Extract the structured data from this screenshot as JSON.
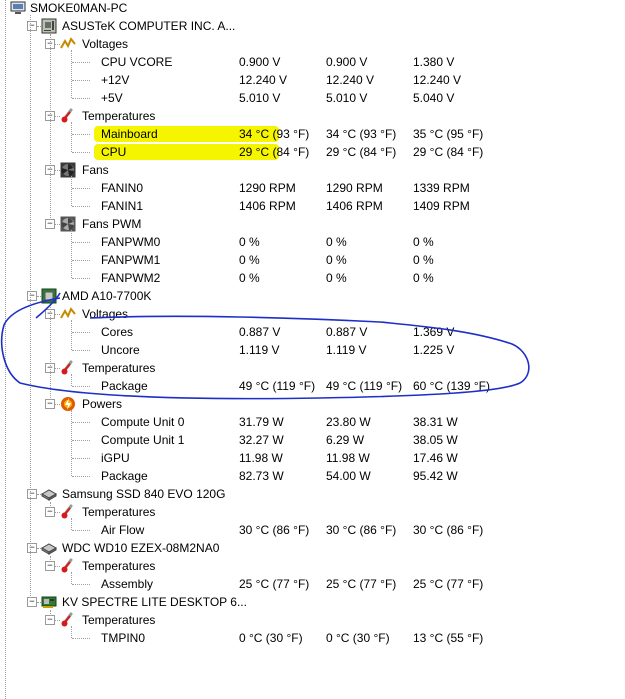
{
  "root": {
    "label": "SMOKE0MAN-PC"
  },
  "nodes": [
    {
      "id": "asus",
      "label": "ASUSTeK COMPUTER INC. A...",
      "icon": "motherboard-icon",
      "groups": [
        {
          "label": "Voltages",
          "icon": "voltage-icon",
          "rows": [
            {
              "name": "CPU VCORE",
              "v": [
                "0.900 V",
                "0.900 V",
                "1.380 V"
              ]
            },
            {
              "name": "+12V",
              "v": [
                "12.240 V",
                "12.240 V",
                "12.240 V"
              ]
            },
            {
              "name": "+5V",
              "v": [
                "5.010 V",
                "5.010 V",
                "5.040 V"
              ]
            }
          ]
        },
        {
          "label": "Temperatures",
          "icon": "thermometer-icon",
          "rows": [
            {
              "name": "Mainboard",
              "v": [
                "34 °C  (93 °F)",
                "34 °C  (93 °F)",
                "35 °C  (95 °F)"
              ],
              "highlight": true
            },
            {
              "name": "CPU",
              "v": [
                "29 °C  (84 °F)",
                "29 °C  (84 °F)",
                "29 °C  (84 °F)"
              ],
              "highlight": true
            }
          ]
        },
        {
          "label": "Fans",
          "icon": "fan-icon",
          "rows": [
            {
              "name": "FANIN0",
              "v": [
                "1290 RPM",
                "1290 RPM",
                "1339 RPM"
              ]
            },
            {
              "name": "FANIN1",
              "v": [
                "1406 RPM",
                "1406 RPM",
                "1409 RPM"
              ]
            }
          ]
        },
        {
          "label": "Fans PWM",
          "icon": "fan-pwm-icon",
          "rows": [
            {
              "name": "FANPWM0",
              "v": [
                "0 %",
                "0 %",
                "0 %"
              ]
            },
            {
              "name": "FANPWM1",
              "v": [
                "0 %",
                "0 %",
                "0 %"
              ]
            },
            {
              "name": "FANPWM2",
              "v": [
                "0 %",
                "0 %",
                "0 %"
              ]
            }
          ]
        }
      ]
    },
    {
      "id": "amd",
      "label": "AMD A10-7700K",
      "icon": "cpu-chip-icon",
      "groups": [
        {
          "label": "Voltages",
          "icon": "voltage-icon",
          "rows": [
            {
              "name": "Cores",
              "v": [
                "0.887 V",
                "0.887 V",
                "1.369 V"
              ]
            },
            {
              "name": "Uncore",
              "v": [
                "1.119 V",
                "1.119 V",
                "1.225 V"
              ]
            }
          ]
        },
        {
          "label": "Temperatures",
          "icon": "thermometer-icon",
          "rows": [
            {
              "name": "Package",
              "v": [
                "49 °C  (119 °F)",
                "49 °C  (119 °F)",
                "60 °C  (139 °F)"
              ]
            }
          ]
        },
        {
          "label": "Powers",
          "icon": "power-icon",
          "rows": [
            {
              "name": "Compute Unit 0",
              "v": [
                "31.79 W",
                "23.80 W",
                "38.31 W"
              ]
            },
            {
              "name": "Compute Unit 1",
              "v": [
                "32.27 W",
                "6.29 W",
                "38.05 W"
              ]
            },
            {
              "name": "iGPU",
              "v": [
                "11.98 W",
                "11.98 W",
                "17.46 W"
              ]
            },
            {
              "name": "Package",
              "v": [
                "82.73 W",
                "54.00 W",
                "95.42 W"
              ]
            }
          ]
        }
      ]
    },
    {
      "id": "ssd",
      "label": "Samsung SSD 840 EVO 120G",
      "icon": "disk-drive-icon",
      "groups": [
        {
          "label": "Temperatures",
          "icon": "thermometer-icon",
          "rows": [
            {
              "name": "Air Flow",
              "v": [
                "30 °C  (86 °F)",
                "30 °C  (86 °F)",
                "30 °C  (86 °F)"
              ]
            }
          ]
        }
      ]
    },
    {
      "id": "wdc",
      "label": "WDC WD10 EZEX-08M2NA0",
      "icon": "disk-drive-icon",
      "groups": [
        {
          "label": "Temperatures",
          "icon": "thermometer-icon",
          "rows": [
            {
              "name": "Assembly",
              "v": [
                "25 °C  (77 °F)",
                "25 °C  (77 °F)",
                "25 °C  (77 °F)"
              ]
            }
          ]
        }
      ]
    },
    {
      "id": "kv",
      "label": "KV SPECTRE LITE DESKTOP 6...",
      "icon": "graphics-card-icon",
      "groups": [
        {
          "label": "Temperatures",
          "icon": "thermometer-icon",
          "rows": [
            {
              "name": "TMPIN0",
              "v": [
                "0 °C  (30 °F)",
                "0 °C  (30 °F)",
                "13 °C  (55 °F)"
              ]
            }
          ]
        }
      ]
    }
  ],
  "colors": {
    "highlight": "#f5f500",
    "annotation": "#1e2fc8"
  }
}
